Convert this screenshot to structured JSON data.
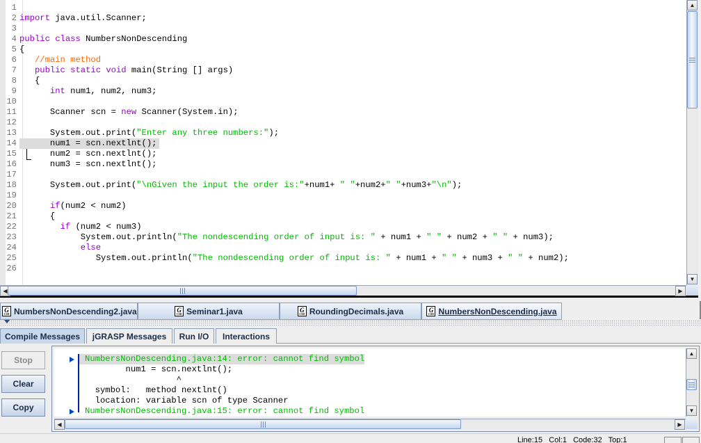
{
  "editor": {
    "cursor_line": 15,
    "highlighted_line": 14,
    "lines": [
      {
        "n": "1",
        "segs": []
      },
      {
        "n": "2",
        "segs": [
          {
            "t": "kw",
            "v": "import"
          },
          {
            "t": "",
            "v": " java.util.Scanner;"
          }
        ]
      },
      {
        "n": "3",
        "segs": []
      },
      {
        "n": "4",
        "segs": [
          {
            "t": "kw",
            "v": "public class"
          },
          {
            "t": "",
            "v": " NumbersNonDescending"
          }
        ]
      },
      {
        "n": "5",
        "segs": [
          {
            "t": "",
            "v": "{"
          }
        ]
      },
      {
        "n": "6",
        "segs": [
          {
            "t": "",
            "v": "   "
          },
          {
            "t": "cm",
            "v": "//main method"
          }
        ]
      },
      {
        "n": "7",
        "segs": [
          {
            "t": "",
            "v": "   "
          },
          {
            "t": "kw",
            "v": "public static void"
          },
          {
            "t": "",
            "v": " main(String [] args)"
          }
        ]
      },
      {
        "n": "8",
        "segs": [
          {
            "t": "",
            "v": "   {"
          }
        ]
      },
      {
        "n": "9",
        "segs": [
          {
            "t": "",
            "v": "      "
          },
          {
            "t": "kw",
            "v": "int"
          },
          {
            "t": "",
            "v": " num1, num2, num3;"
          }
        ]
      },
      {
        "n": "10",
        "segs": []
      },
      {
        "n": "11",
        "segs": [
          {
            "t": "",
            "v": "      Scanner scn = "
          },
          {
            "t": "kw",
            "v": "new"
          },
          {
            "t": "",
            "v": " Scanner(System.in);"
          }
        ]
      },
      {
        "n": "12",
        "segs": []
      },
      {
        "n": "13",
        "segs": [
          {
            "t": "",
            "v": "      System.out.print("
          },
          {
            "t": "str",
            "v": "\"Enter any three numbers:\""
          },
          {
            "t": "",
            "v": ");"
          }
        ]
      },
      {
        "n": "14",
        "segs": [
          {
            "t": "",
            "v": "      num1 = scn.nextlnt();"
          }
        ]
      },
      {
        "n": "15",
        "segs": [
          {
            "t": "",
            "v": "      num2 = scn.nextlnt();"
          }
        ]
      },
      {
        "n": "16",
        "segs": [
          {
            "t": "",
            "v": "      num3 = scn.nextlnt();"
          }
        ]
      },
      {
        "n": "17",
        "segs": []
      },
      {
        "n": "18",
        "segs": [
          {
            "t": "",
            "v": "      System.out.print("
          },
          {
            "t": "str",
            "v": "\"\\nGiven the input the order is:\""
          },
          {
            "t": "",
            "v": "+num1+ "
          },
          {
            "t": "str",
            "v": "\" \""
          },
          {
            "t": "",
            "v": "+num2+"
          },
          {
            "t": "str",
            "v": "\" \""
          },
          {
            "t": "",
            "v": "+num3+"
          },
          {
            "t": "str",
            "v": "\"\\n\""
          },
          {
            "t": "",
            "v": ");"
          }
        ]
      },
      {
        "n": "19",
        "segs": []
      },
      {
        "n": "20",
        "segs": [
          {
            "t": "",
            "v": "      "
          },
          {
            "t": "kw",
            "v": "if"
          },
          {
            "t": "",
            "v": "(num2 < num2)"
          }
        ]
      },
      {
        "n": "21",
        "segs": [
          {
            "t": "",
            "v": "      {"
          }
        ]
      },
      {
        "n": "22",
        "segs": [
          {
            "t": "",
            "v": "        "
          },
          {
            "t": "kw",
            "v": "if"
          },
          {
            "t": "",
            "v": " (num2 < num3)"
          }
        ]
      },
      {
        "n": "23",
        "segs": [
          {
            "t": "",
            "v": "            System.out.println("
          },
          {
            "t": "str",
            "v": "\"The nondescending order of input is: \""
          },
          {
            "t": "",
            "v": " + num1 + "
          },
          {
            "t": "str",
            "v": "\" \""
          },
          {
            "t": "",
            "v": " + num2 + "
          },
          {
            "t": "str",
            "v": "\" \""
          },
          {
            "t": "",
            "v": " + num3);"
          }
        ]
      },
      {
        "n": "24",
        "segs": [
          {
            "t": "",
            "v": "            "
          },
          {
            "t": "kw",
            "v": "else"
          }
        ]
      },
      {
        "n": "25",
        "segs": [
          {
            "t": "",
            "v": "               System.out.println("
          },
          {
            "t": "str",
            "v": "\"The nondescending order of input is: \""
          },
          {
            "t": "",
            "v": " + num1 + "
          },
          {
            "t": "str",
            "v": "\" \""
          },
          {
            "t": "",
            "v": " + num3 + "
          },
          {
            "t": "str",
            "v": "\" \""
          },
          {
            "t": "",
            "v": " + num2);"
          }
        ]
      },
      {
        "n": "26",
        "segs": []
      }
    ]
  },
  "file_tabs": [
    {
      "label": "NumbersNonDescending2.java",
      "icon": "jgrasp-csd-icon",
      "active": false
    },
    {
      "label": "Seminar1.java",
      "icon": "jgrasp-csd-icon",
      "active": false
    },
    {
      "label": "RoundingDecimals.java",
      "icon": "jgrasp-csd-icon",
      "active": false
    },
    {
      "label": "NumbersNonDescending.java",
      "icon": "jgrasp-csd-icon",
      "active": true
    }
  ],
  "message_tabs": [
    {
      "label": "Compile Messages",
      "active": true
    },
    {
      "label": "jGRASP Messages",
      "active": false
    },
    {
      "label": "Run I/O",
      "active": false
    },
    {
      "label": "Interactions",
      "active": false
    }
  ],
  "side_buttons": {
    "stop": "Stop",
    "clear": "Clear",
    "copy": "Copy"
  },
  "messages": [
    {
      "text": "NumbersNonDescending.java:14: error: cannot find symbol",
      "type": "error",
      "marker": true,
      "highlighted": true
    },
    {
      "text": "        num1 = scn.nextlnt();",
      "type": "plain",
      "marker": false
    },
    {
      "text": "                  ^",
      "type": "plain",
      "marker": false
    },
    {
      "text": "  symbol:   method nextlnt()",
      "type": "plain",
      "marker": false
    },
    {
      "text": "  location: variable scn of type Scanner",
      "type": "plain",
      "marker": false
    },
    {
      "text": "NumbersNonDescending.java:15: error: cannot find symbol",
      "type": "error",
      "marker": true,
      "highlighted": false
    }
  ],
  "status_bar": {
    "text": "Line:15   Col:1   Code:32   Top:1"
  },
  "colors": {
    "keyword": "#9900cc",
    "string": "#00bb00",
    "comment": "#ff6600",
    "error_text": "#00bb00",
    "marker": "#0044cc"
  }
}
